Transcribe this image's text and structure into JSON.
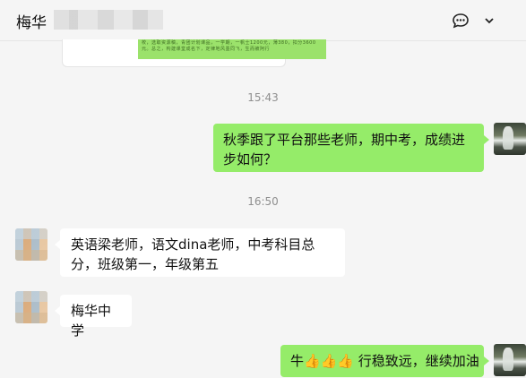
{
  "header": {
    "title": "梅华",
    "more_icon": "chat-bubble-dots-icon",
    "dropdown_icon": "chevron-down-icon"
  },
  "shared_card": {
    "snippet": "校，选取资源稿，青团计划课品，一学期，一帆士1200元，薄380，扣分3600元。总之，构建课堂成名下，定律地风墨同飞，生而被阿行"
  },
  "messages": [
    {
      "type": "time",
      "text": "15:43"
    },
    {
      "type": "outgoing",
      "text": "秋季跟了平台那些老师，期中考，成绩进步如何？"
    },
    {
      "type": "time",
      "text": "16:50"
    },
    {
      "type": "incoming",
      "text": "英语梁老师，语文dina老师，中考科目总分，班级第一，年级第五"
    },
    {
      "type": "incoming",
      "text": "梅华中学"
    },
    {
      "type": "outgoing",
      "text": "牛👍👍👍 行稳致远，继续加油"
    }
  ],
  "colors": {
    "background": "#f5f5f5",
    "outgoing_bubble": "#95ec69",
    "incoming_bubble": "#ffffff",
    "timestamp": "#8f8f8f"
  }
}
